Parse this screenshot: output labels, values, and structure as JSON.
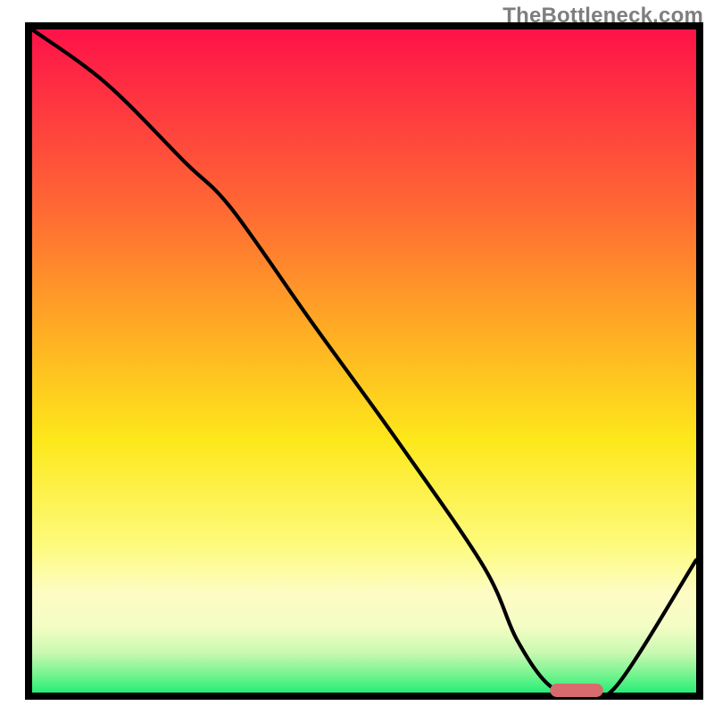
{
  "attribution": "TheBottleneck.com",
  "colors": {
    "top": "#fe1249",
    "mid_upper": "#ff8f2d",
    "mid": "#fced1a",
    "lower_yellow": "#fdfcb6",
    "pale": "#eefec3",
    "green": "#27ee76",
    "line": "#000000",
    "frame": "#000000",
    "marker": "#d86b6e"
  },
  "chart_data": {
    "type": "line",
    "title": "",
    "xlabel": "",
    "ylabel": "",
    "xlim": [
      0,
      100
    ],
    "ylim": [
      0,
      100
    ],
    "x": [
      0,
      11,
      23,
      30,
      42,
      55,
      68,
      73,
      78,
      83,
      88,
      100
    ],
    "values": [
      100,
      92,
      80,
      73,
      56,
      38,
      19,
      8,
      1,
      0,
      1,
      20
    ],
    "optimal_marker": {
      "x_start": 78,
      "x_end": 86,
      "y": 0
    },
    "background_gradient_meaning": "red = high bottleneck, green = optimal"
  }
}
